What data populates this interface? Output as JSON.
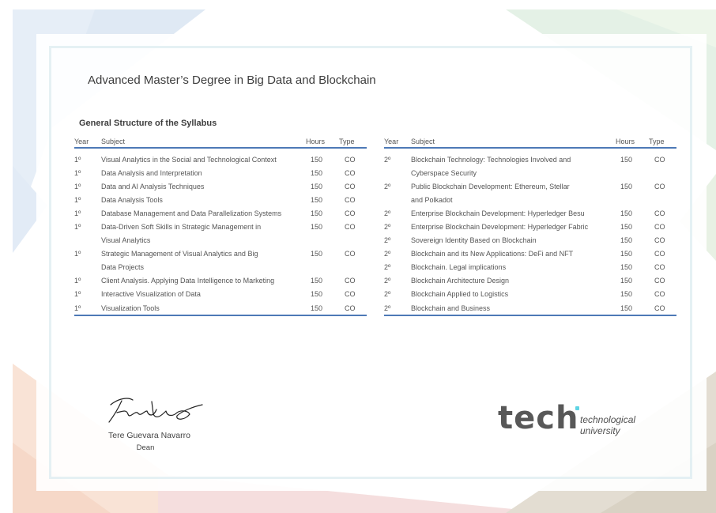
{
  "document": {
    "title": "Advanced Master’s Degree in Big Data and Blockchain",
    "subtitle": "General Structure of the Syllabus"
  },
  "table_headers": {
    "year": "Year",
    "subject": "Subject",
    "hours": "Hours",
    "type": "Type"
  },
  "left_table": {
    "rows": [
      {
        "year": "1º",
        "subject": "Visual Analytics in the Social and Technological Context",
        "hours": "150",
        "type": "CO"
      },
      {
        "year": "1º",
        "subject": "Data Analysis and Interpretation",
        "hours": "150",
        "type": "CO"
      },
      {
        "year": "1º",
        "subject": "Data and AI Analysis Techniques",
        "hours": "150",
        "type": "CO"
      },
      {
        "year": "1º",
        "subject": "Data Analysis Tools",
        "hours": "150",
        "type": "CO"
      },
      {
        "year": "1º",
        "subject": "Database Management and Data Parallelization Systems",
        "hours": "150",
        "type": "CO"
      },
      {
        "year": "1º",
        "subject": "Data-Driven Soft Skills in Strategic Management in",
        "hours": "150",
        "type": "CO"
      },
      {
        "year": "",
        "subject": "Visual Analytics",
        "hours": "",
        "type": ""
      },
      {
        "year": "1º",
        "subject": "Strategic Management of Visual Analytics and Big",
        "hours": "150",
        "type": "CO"
      },
      {
        "year": "",
        "subject": "Data Projects",
        "hours": "",
        "type": ""
      },
      {
        "year": "1º",
        "subject": "Client Analysis. Applying Data Intelligence to Marketing",
        "hours": "150",
        "type": "CO"
      },
      {
        "year": "1º",
        "subject": "Interactive Visualization of Data",
        "hours": "150",
        "type": "CO"
      },
      {
        "year": "1º",
        "subject": "Visualization Tools",
        "hours": "150",
        "type": "CO"
      }
    ]
  },
  "right_table": {
    "rows": [
      {
        "year": "2º",
        "subject": "Blockchain Technology: Technologies Involved and",
        "hours": "150",
        "type": "CO"
      },
      {
        "year": "",
        "subject": "Cyberspace Security",
        "hours": "",
        "type": ""
      },
      {
        "year": "2º",
        "subject": "Public Blockchain Development: Ethereum, Stellar",
        "hours": "150",
        "type": "CO"
      },
      {
        "year": "",
        "subject": "and Polkadot",
        "hours": "",
        "type": ""
      },
      {
        "year": "2º",
        "subject": "Enterprise Blockchain Development: Hyperledger Besu",
        "hours": "150",
        "type": "CO"
      },
      {
        "year": "2º",
        "subject": "Enterprise Blockchain Development: Hyperledger Fabric",
        "hours": "150",
        "type": "CO"
      },
      {
        "year": "2º",
        "subject": "Sovereign Identity Based on Blockchain",
        "hours": "150",
        "type": "CO"
      },
      {
        "year": "2º",
        "subject": "Blockchain and its New Applications: DeFi and NFT",
        "hours": "150",
        "type": "CO"
      },
      {
        "year": "2º",
        "subject": "Blockchain. Legal implications",
        "hours": "150",
        "type": "CO"
      },
      {
        "year": "2º",
        "subject": "Blockchain Architecture Design",
        "hours": "150",
        "type": "CO"
      },
      {
        "year": "2º",
        "subject": "Blockchain Applied to Logistics",
        "hours": "150",
        "type": "CO"
      },
      {
        "year": "2º",
        "subject": "Blockchain and Business",
        "hours": "150",
        "type": "CO"
      }
    ]
  },
  "signatory": {
    "name": "Tere Guevara Navarro",
    "role": "Dean"
  },
  "logo": {
    "wordmark": "tech",
    "line1": "technological",
    "line2": "university",
    "accent": "#5fd4e4"
  },
  "colors": {
    "table_rule": "#4d79b6",
    "text": "#444444"
  }
}
